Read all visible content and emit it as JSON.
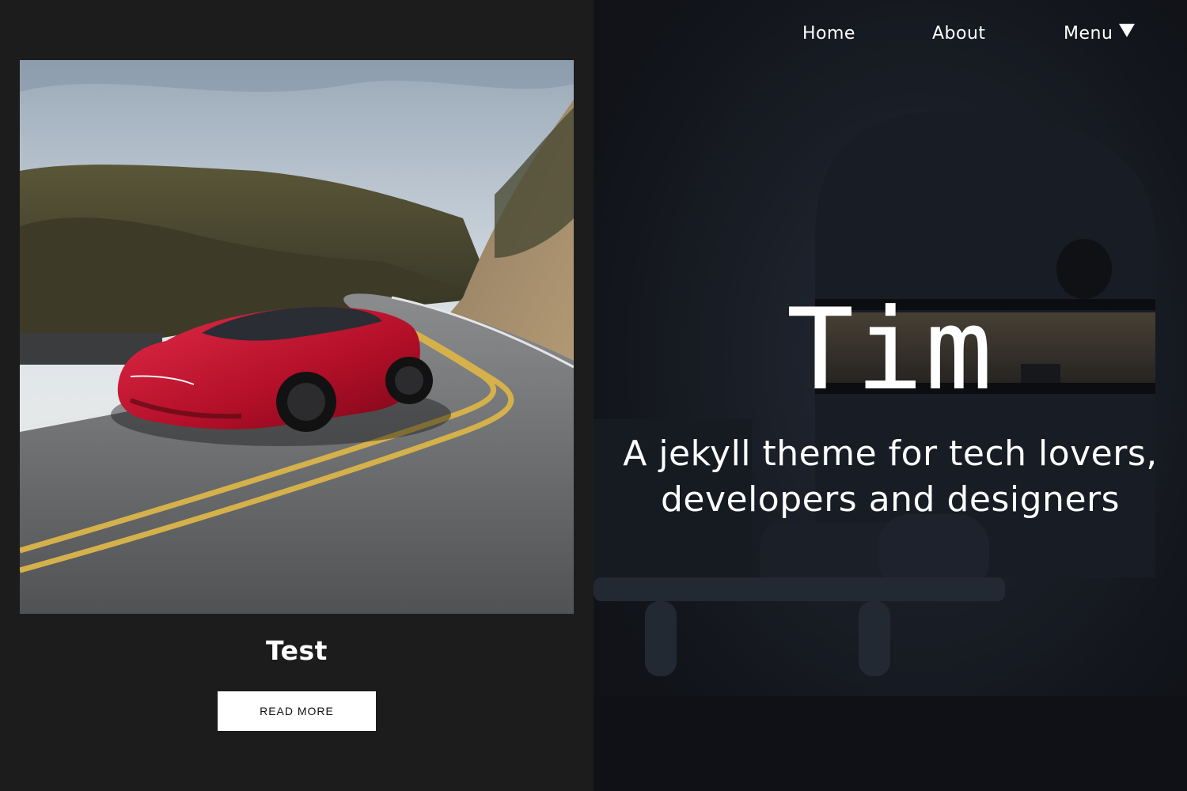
{
  "post": {
    "image_alt": "Red sports car on a winding mountain road",
    "title": "Test",
    "read_more_label": "READ MORE"
  },
  "nav": {
    "home": "Home",
    "about": "About",
    "menu": "Menu"
  },
  "hero": {
    "title": "Tim",
    "subtitle_line1": "A jekyll theme for tech lovers,",
    "subtitle_line2": "developers and designers"
  },
  "colors": {
    "page_background": "#1c1c1c",
    "hero_background": "#191d24",
    "button_background": "#ffffff",
    "text": "#ffffff"
  },
  "icons": {
    "menu_caret": "triangle-down"
  }
}
